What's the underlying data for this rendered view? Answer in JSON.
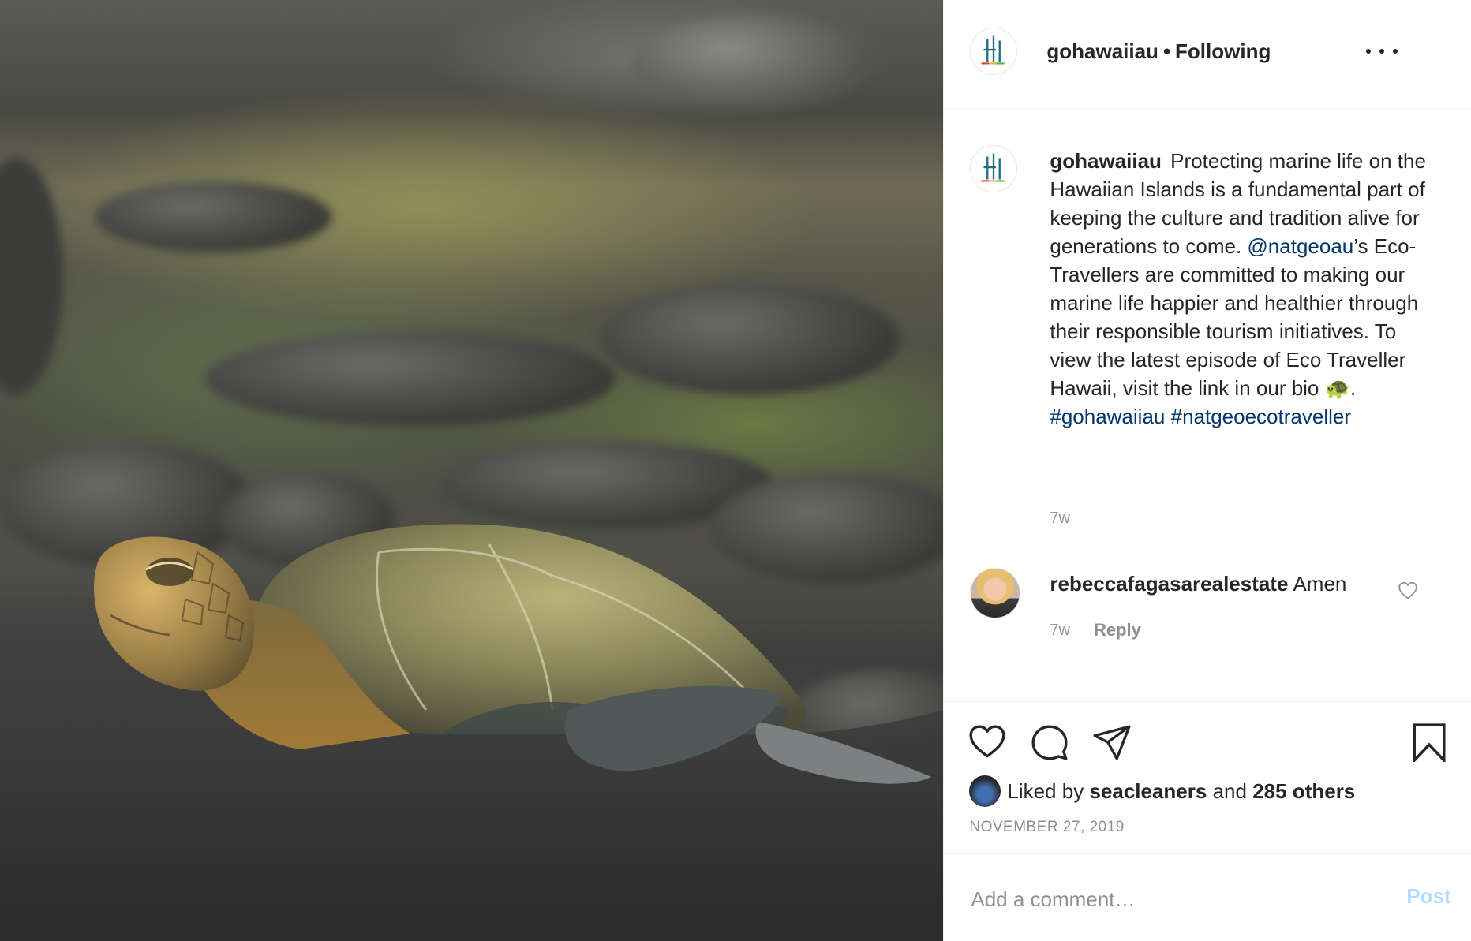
{
  "post": {
    "image_alt": "Sea turtle resting on black sand beach"
  },
  "header": {
    "username": "gohawaiiau",
    "separator": "•",
    "follow_status": "Following",
    "more_icon": "more-horizontal-icon"
  },
  "caption": {
    "username": "gohawaiiau",
    "text_1": "Protecting marine life on the Hawaiian Islands is a fundamental part of keeping the culture and tradition alive for generations to come.",
    "mention": "@natgeoau",
    "text_2": "’s Eco-Travellers are committed to making our marine life happier and healthier through their responsible tourism initiatives. To view the latest episode of Eco Traveller Hawaii, visit the link in our bio",
    "emoji": "🐢",
    "text_3": ".",
    "hashtag_1": "#gohawaiiau",
    "hashtag_2": "#natgeoecotraveller",
    "time": "7w"
  },
  "comment": {
    "username": "rebeccafagasarealestate",
    "text": "Amen",
    "time": "7w",
    "reply_label": "Reply"
  },
  "actions": {
    "like_icon": "heart-icon",
    "comment_icon": "comment-bubble-icon",
    "share_icon": "paper-plane-icon",
    "save_icon": "bookmark-icon"
  },
  "likes": {
    "prefix": "Liked by",
    "user": "seacleaners",
    "middle": "and",
    "others": "285 others"
  },
  "date": "NOVEMBER 27, 2019",
  "add_comment": {
    "placeholder": "Add a comment…",
    "post_label": "Post"
  },
  "colors": {
    "link": "#00376b",
    "muted": "#8e8e8e",
    "post_disabled": "#b3dbff",
    "logo_teal": "#1e6e80",
    "logo_red": "#e03c31",
    "logo_orange": "#f5a623",
    "logo_green": "#4caf50"
  }
}
